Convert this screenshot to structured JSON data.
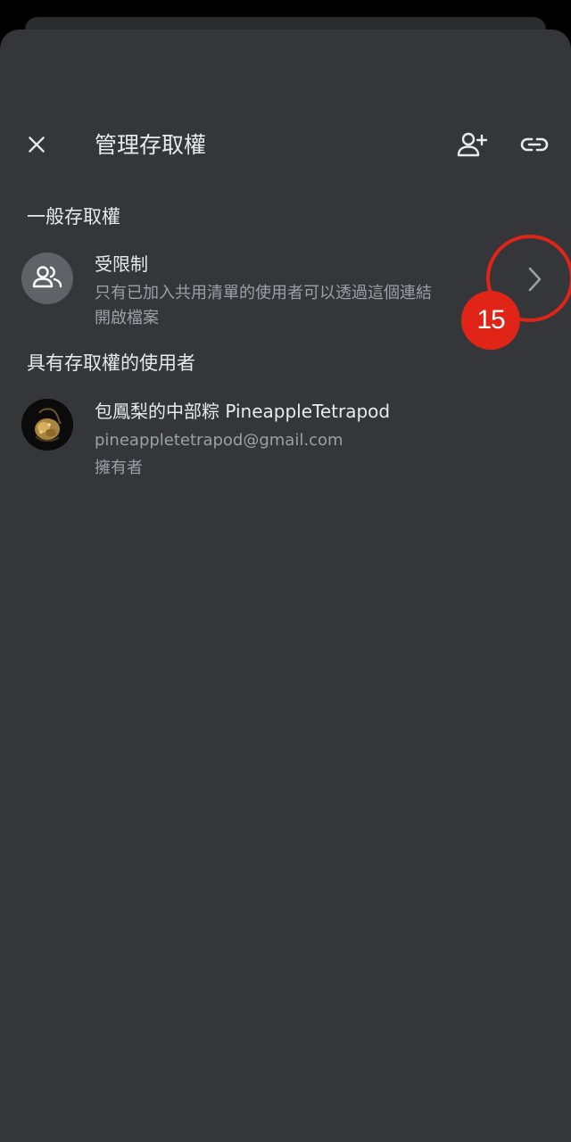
{
  "header": {
    "title": "管理存取權",
    "close_icon": "close-icon",
    "add_person_icon": "person-add-icon",
    "link_icon": "link-icon"
  },
  "general_access": {
    "heading": "一般存取權",
    "icon": "people-icon",
    "title": "受限制",
    "description_line1": "只有已加入共用清單的使用者可以透過這個連結",
    "description_line2": "開啟檔案",
    "chevron_icon": "chevron-right-icon"
  },
  "people_with_access": {
    "heading": "具有存取權的使用者",
    "users": [
      {
        "name": "包鳳梨的中部粽 PineappleTetrapod",
        "email": "pineappletetrapod@gmail.com",
        "role": "擁有者"
      }
    ]
  },
  "annotation": {
    "step_number": "15",
    "color": "#e02418"
  },
  "colors": {
    "sheet_background": "#35363a",
    "primary_text": "#e8eaed",
    "secondary_text": "#9aa0a6"
  }
}
